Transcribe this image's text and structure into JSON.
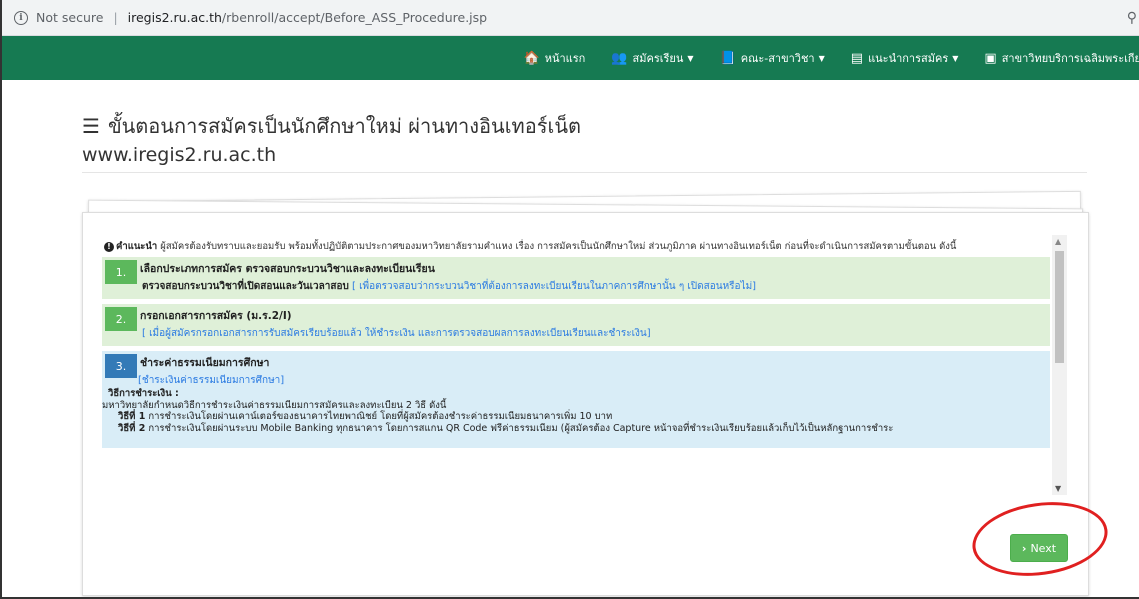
{
  "browser": {
    "security": "Not secure",
    "host": "iregis2.ru.ac.th",
    "path": "/rbenroll/accept/Before_ASS_Procedure.jsp"
  },
  "nav": {
    "items": [
      {
        "icon": "home-icon",
        "glyph": "🏠",
        "label": "หน้าแรก",
        "caret": false
      },
      {
        "icon": "user-plus-icon",
        "glyph": "👥",
        "label": "สมัครเรียน",
        "caret": true
      },
      {
        "icon": "book-icon",
        "glyph": "📘",
        "label": "คณะ-สาขาวิชา",
        "caret": true
      },
      {
        "icon": "list-alt-icon",
        "glyph": "▤",
        "label": "แนะนำการสมัคร",
        "caret": true
      },
      {
        "icon": "card-icon",
        "glyph": "▣",
        "label": "สาขาวิทยบริการเฉลิมพระเกีย",
        "caret": false
      }
    ]
  },
  "heading": {
    "title": "ขั้นตอนการสมัครเป็นนักศึกษาใหม่ ผ่านทางอินเทอร์เน็ต",
    "site": "www.iregis2.ru.ac.th"
  },
  "note": {
    "label": "คำแนะนำ",
    "text": " ผู้สมัครต้องรับทราบและยอมรับ พร้อมทั้งปฏิบัติตามประกาศของมหาวิทยาลัยรามคำแหง เรื่อง การสมัครเป็นนักศึกษาใหม่ ส่วนภูมิภาค ผ่านทางอินเทอร์เน็ต ก่อนที่จะดำเนินการสมัครตามขั้นตอน ดังนี้"
  },
  "steps": [
    {
      "num": "1.",
      "title": "เลือกประเภทการสมัคร ตรวจสอบกระบวนวิชาและลงทะเบียนเรียน",
      "sub_bold": "ตรวจสอบกระบวนวิชาที่เปิดสอนและวันเวลาสอบ",
      "sub_link": "[ เพื่อตรวจสอบว่ากระบวนวิชาที่ต้องการลงทะเบียนเรียนในภาคการศึกษานั้น ๆ เปิดสอนหรือไม่]"
    },
    {
      "num": "2.",
      "title": "กรอกเอกสารการสมัคร (ม.ร.2/I)",
      "sub_link": "[ เมื่อผู้สมัครกรอกเอกสารการรับสมัครเรียบร้อยแล้ว ให้ชำระเงิน และการตรวจสอบผลการลงทะเบียนเรียนและชำระเงิน]"
    },
    {
      "num": "3.",
      "title": "ชำระค่าธรรมเนียมการศึกษา",
      "sub_link": "[ชำระเงินค่าธรรมเนียมการศึกษา]",
      "method_label": "วิธีการชำระเงิน :",
      "method_intro": "มหาวิทยาลัยกำหนดวิธีการชำระเงินค่าธรรมเนียมการสมัครและลงทะเบียน 2 วิธี ดังนี้",
      "methods": [
        {
          "label": "วิธีที่ 1",
          "text": "การชำระเงินโดยผ่านเคาน์เตอร์ของธนาคารไทยพาณิชย์ โดยที่ผู้สมัครต้องชำระค่าธรรมเนียมธนาคารเพิ่ม 10 บาท"
        },
        {
          "label": "วิธีที่ 2",
          "text": "การชำระเงินโดยผ่านระบบ Mobile Banking ทุกธนาคาร โดยการสแกน QR Code ฟรีค่าธรรมเนียม (ผู้สมัครต้อง Capture หน้าจอที่ชำระเงินเรียบร้อยแล้วเก็บไว้เป็นหลักฐานการชำระ"
        }
      ]
    }
  ],
  "next_label": "Next",
  "colors": {
    "nav": "#167a52",
    "green_box": "#dff0d8",
    "blue_box": "#d9edf7",
    "next": "#5cb85c",
    "annotation": "#e02020"
  }
}
